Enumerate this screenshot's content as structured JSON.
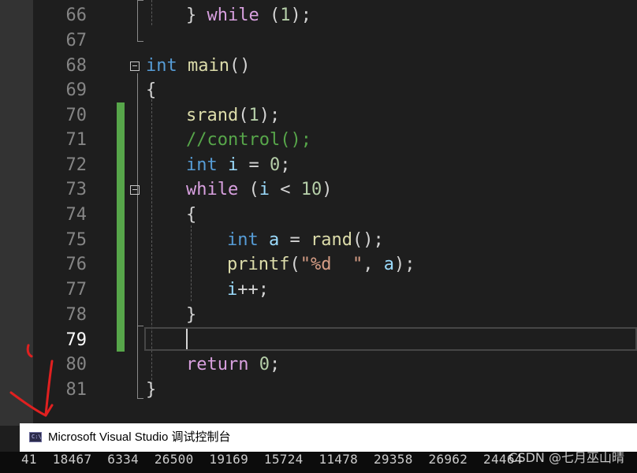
{
  "editor": {
    "lines": [
      {
        "n": "66",
        "tokens": [
          {
            "t": "} ",
            "c": "pl"
          },
          {
            "t": "while",
            "c": "ctrl"
          },
          {
            "t": " (",
            "c": "pl"
          },
          {
            "t": "1",
            "c": "num"
          },
          {
            "t": ");",
            "c": "pl"
          }
        ]
      },
      {
        "n": "67",
        "tokens": []
      },
      {
        "n": "68",
        "tokens": [
          {
            "t": "int",
            "c": "kw"
          },
          {
            "t": " ",
            "c": "pl"
          },
          {
            "t": "main",
            "c": "fn"
          },
          {
            "t": "()",
            "c": "pl"
          }
        ]
      },
      {
        "n": "69",
        "tokens": [
          {
            "t": "{",
            "c": "pl"
          }
        ]
      },
      {
        "n": "70",
        "tokens": [
          {
            "t": "srand",
            "c": "fn"
          },
          {
            "t": "(",
            "c": "pl"
          },
          {
            "t": "1",
            "c": "num"
          },
          {
            "t": ");",
            "c": "pl"
          }
        ]
      },
      {
        "n": "71",
        "tokens": [
          {
            "t": "//control();",
            "c": "cmt"
          }
        ]
      },
      {
        "n": "72",
        "tokens": [
          {
            "t": "int",
            "c": "kw"
          },
          {
            "t": " ",
            "c": "pl"
          },
          {
            "t": "i",
            "c": "var"
          },
          {
            "t": " = ",
            "c": "pl"
          },
          {
            "t": "0",
            "c": "num"
          },
          {
            "t": ";",
            "c": "pl"
          }
        ]
      },
      {
        "n": "73",
        "tokens": [
          {
            "t": "while",
            "c": "ctrl"
          },
          {
            "t": " (",
            "c": "pl"
          },
          {
            "t": "i",
            "c": "var"
          },
          {
            "t": " < ",
            "c": "pl"
          },
          {
            "t": "10",
            "c": "num"
          },
          {
            "t": ")",
            "c": "pl"
          }
        ]
      },
      {
        "n": "74",
        "tokens": [
          {
            "t": "{",
            "c": "pl"
          }
        ]
      },
      {
        "n": "75",
        "tokens": [
          {
            "t": "int",
            "c": "kw"
          },
          {
            "t": " ",
            "c": "pl"
          },
          {
            "t": "a",
            "c": "var"
          },
          {
            "t": " = ",
            "c": "pl"
          },
          {
            "t": "rand",
            "c": "fn"
          },
          {
            "t": "();",
            "c": "pl"
          }
        ]
      },
      {
        "n": "76",
        "tokens": [
          {
            "t": "printf",
            "c": "fn"
          },
          {
            "t": "(",
            "c": "pl"
          },
          {
            "t": "\"%d  \"",
            "c": "str"
          },
          {
            "t": ", ",
            "c": "pl"
          },
          {
            "t": "a",
            "c": "var"
          },
          {
            "t": ");",
            "c": "pl"
          }
        ]
      },
      {
        "n": "77",
        "tokens": [
          {
            "t": "i",
            "c": "var"
          },
          {
            "t": "++;",
            "c": "pl"
          }
        ]
      },
      {
        "n": "78",
        "tokens": [
          {
            "t": "}",
            "c": "pl"
          }
        ]
      },
      {
        "n": "79",
        "tokens": []
      },
      {
        "n": "80",
        "tokens": [
          {
            "t": "return",
            "c": "ctrl"
          },
          {
            "t": " ",
            "c": "pl"
          },
          {
            "t": "0",
            "c": "num"
          },
          {
            "t": ";",
            "c": "pl"
          }
        ]
      },
      {
        "n": "81",
        "tokens": [
          {
            "t": "}",
            "c": "pl"
          }
        ]
      }
    ],
    "active_line": "79"
  },
  "console": {
    "title": "Microsoft Visual Studio 调试控制台",
    "icon_label": "C:\\",
    "output_line": "41  18467  6334  26500  19169  15724  11478  29358  26962  24464"
  },
  "watermark": "CSDN @七月巫山晴",
  "colors": {
    "background": "#1e1e1e",
    "keyword": "#569cd6",
    "control": "#d8a0df",
    "function": "#dcdcaa",
    "number": "#b5cea8",
    "variable": "#9cdcfe",
    "string": "#d69d85",
    "comment": "#57a64a",
    "change_bar": "#57a64a",
    "annotation_arrow": "#e02020"
  }
}
